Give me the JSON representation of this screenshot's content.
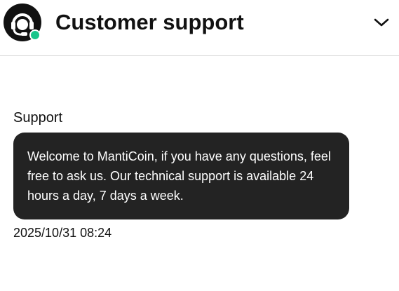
{
  "header": {
    "title": "Customer support",
    "avatar_icon": "headset-agent-icon",
    "status_color": "#19c58a",
    "collapse_icon": "chevron-down-icon"
  },
  "messages": [
    {
      "sender": "Support",
      "text": "Welcome to MantiCoin, if you have any questions, feel free to ask us. Our technical support is available 24 hours a day, 7 days a week.",
      "timestamp": "2025/10/31 08:24"
    }
  ],
  "colors": {
    "bubble_background": "#232323",
    "bubble_text": "#ffffff",
    "online_indicator": "#19c58a"
  }
}
